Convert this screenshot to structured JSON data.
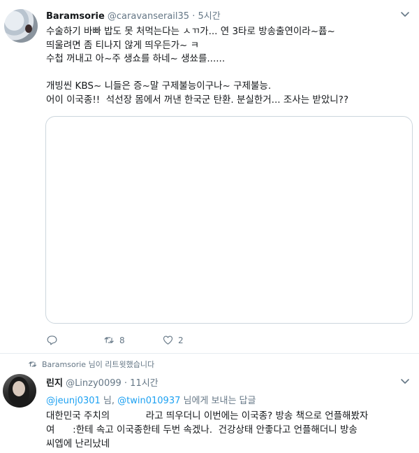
{
  "tweet1": {
    "display_name": "Baramsorie",
    "handle": "@caravanserail35",
    "sep": " · ",
    "time": "5시간",
    "lines": [
      "수술하기 바빠 밥도 못 처먹는다는 ㅅㄲ가... 연 3타로 방송출연이라~퓹~",
      "띄울려면 좀 티나지 않게 띄우든가~ ㅋ",
      "수첩 꺼내고 아~주 생쇼를 하네~ 생쑈를......",
      "",
      "개빙씬 KBS~ 니들은 증~말 구제불능이구나~ 구제불능.",
      "어이 이국종!!  석선장 몸에서 꺼낸 한국군 탄환. 분실한거... 조사는 받았니??"
    ],
    "actions": {
      "reply_count": "",
      "retweet_count": "8",
      "like_count": "2"
    }
  },
  "retweet_notice": "Baramsorie 님이 리트윗했습니다",
  "tweet2": {
    "display_name": "린지",
    "handle": "@Linzy0099",
    "sep": " · ",
    "time": "11시간",
    "reply_to_user1": "@jeunj0301",
    "reply_mid": " 님, ",
    "reply_to_user2": "@twin010937",
    "reply_suffix": " 님에게 보내는 답글",
    "lines": [
      "대한민국 주치의            라고 띄우더니 이번에는 이국종? 방송 책으로 언플해봤자",
      "여      :한테 속고 이국종한테 두번 속겠나.  건강상태 안좋다고 언플해더니 방송",
      "씨엡에 난리났네"
    ]
  },
  "colors": {
    "accent": "#1da1f2",
    "muted": "#657786",
    "border": "#e6ecf0"
  },
  "icons": [
    "chevron-down-icon",
    "reply-icon",
    "retweet-icon",
    "like-icon"
  ]
}
